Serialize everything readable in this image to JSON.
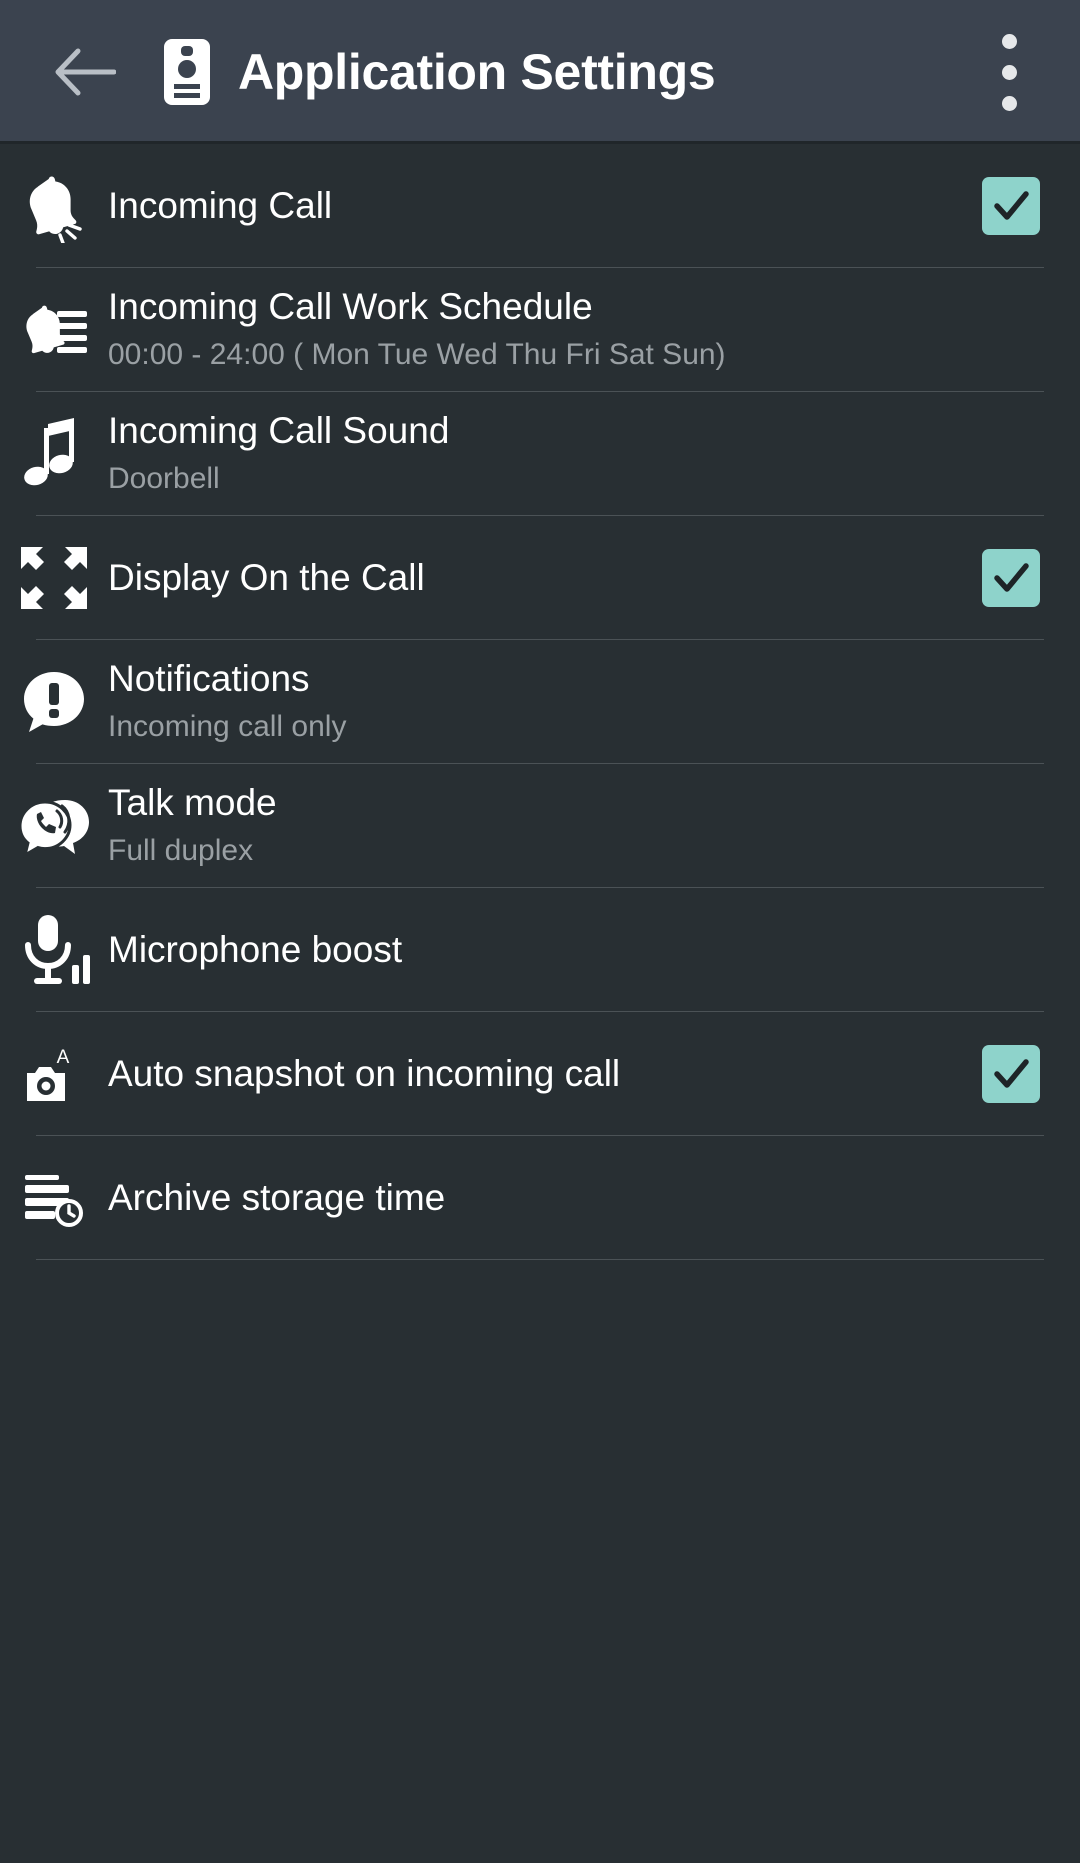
{
  "header": {
    "back_label": "Back",
    "back_icon": "arrow-left-icon",
    "app_icon": "intercom-badge-icon",
    "title": "Application Settings",
    "overflow_label": "More options",
    "overflow_icon": "overflow-menu-icon"
  },
  "colors": {
    "appbar_bg": "#3b434f",
    "page_bg": "#282f33",
    "accent_checkbox": "#8ed3cb",
    "check_mark": "#1e2427",
    "title_text": "#ffffff",
    "subtitle_text": "#9aa0a4",
    "divider": "#4b5256"
  },
  "settings": [
    {
      "id": "incoming-call",
      "icon": "bell-ringing-icon",
      "title": "Incoming Call",
      "subtitle": "",
      "control": "checkbox",
      "checked": true
    },
    {
      "id": "incoming-call-work-schedule",
      "icon": "bell-schedule-icon",
      "title": "Incoming Call Work Schedule",
      "subtitle": "00:00 - 24:00 ( Mon Tue Wed Thu Fri Sat Sun)",
      "control": "none",
      "checked": false
    },
    {
      "id": "incoming-call-sound",
      "icon": "music-note-icon",
      "title": "Incoming Call Sound",
      "subtitle": "Doorbell",
      "control": "none",
      "checked": false
    },
    {
      "id": "display-on-the-call",
      "icon": "fullscreen-expand-icon",
      "title": "Display On the Call",
      "subtitle": "",
      "control": "checkbox",
      "checked": true
    },
    {
      "id": "notifications",
      "icon": "alert-bubble-icon",
      "title": "Notifications",
      "subtitle": "Incoming call only",
      "control": "none",
      "checked": false
    },
    {
      "id": "talk-mode",
      "icon": "talk-bubble-phone-icon",
      "title": "Talk mode",
      "subtitle": "Full duplex",
      "control": "none",
      "checked": false
    },
    {
      "id": "microphone-boost",
      "icon": "microphone-boost-icon",
      "title": "Microphone boost",
      "subtitle": "",
      "control": "none",
      "checked": false
    },
    {
      "id": "auto-snapshot-on-incoming-call",
      "icon": "camera-auto-icon",
      "title": "Auto snapshot on incoming call",
      "subtitle": "",
      "control": "checkbox",
      "checked": true
    },
    {
      "id": "archive-storage-time",
      "icon": "archive-clock-icon",
      "title": "Archive storage time",
      "subtitle": "",
      "control": "none",
      "checked": false
    }
  ]
}
